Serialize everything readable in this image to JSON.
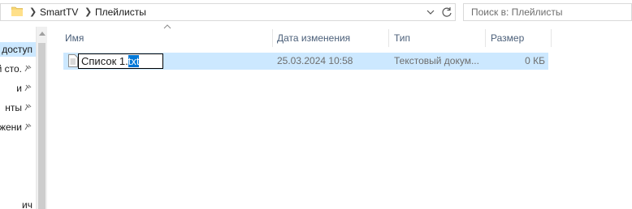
{
  "address_bar": {
    "crumbs": [
      "SmartTV",
      "Плейлисты"
    ]
  },
  "search": {
    "placeholder": "Поиск в: Плейлисты"
  },
  "nav": {
    "items": [
      {
        "label": "доступ",
        "selected": true,
        "pinned": false
      },
      {
        "label": "й сто.",
        "selected": false,
        "pinned": true
      },
      {
        "label": "и",
        "selected": false,
        "pinned": true
      },
      {
        "label": "нты",
        "selected": false,
        "pinned": true
      },
      {
        "label": "жени",
        "selected": false,
        "pinned": true
      },
      {
        "label": "ич",
        "selected": false,
        "pinned": false
      }
    ]
  },
  "columns": {
    "name": "Имя",
    "date": "Дата изменения",
    "type": "Тип",
    "size": "Размер"
  },
  "files": [
    {
      "name_base": "Список 1.",
      "name_ext": "txt",
      "date": "25.03.2024 10:58",
      "type": "Текстовый докум...",
      "size": "0 КБ"
    }
  ],
  "colors": {
    "selection": "#cce8ff",
    "text_selection": "#0078d7",
    "header_text": "#4c607a"
  }
}
